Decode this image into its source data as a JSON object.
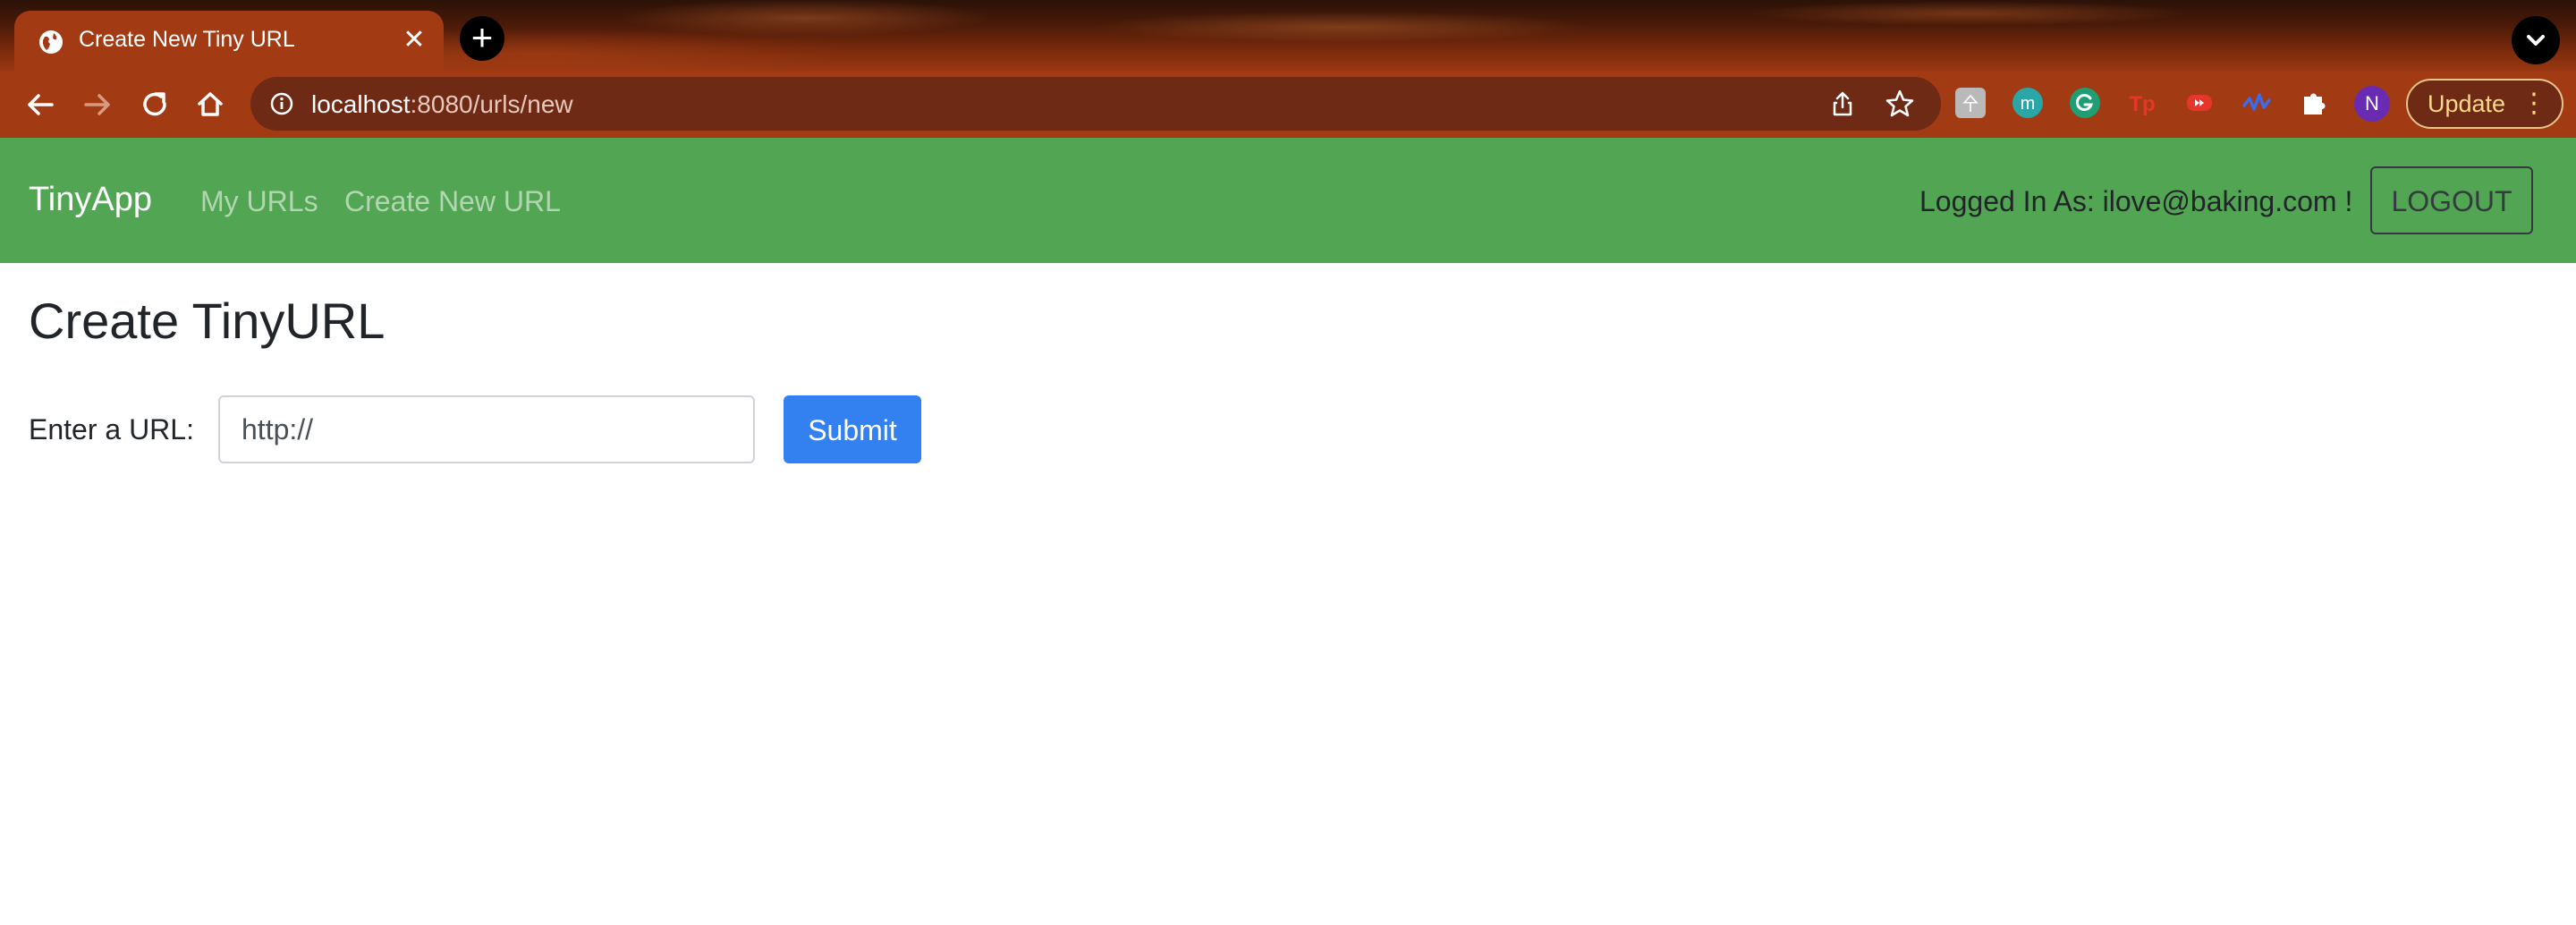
{
  "browser": {
    "tab_title": "Create New Tiny URL",
    "url_host": "localhost",
    "url_rest": ":8080/urls/new",
    "profile_initial": "N",
    "update_label": "Update"
  },
  "navbar": {
    "brand": "TinyApp",
    "links": [
      "My URLs",
      "Create New URL"
    ],
    "logged_in_text": "Logged In As: ilove@baking.com !",
    "logout_label": "LOGOUT"
  },
  "main": {
    "heading": "Create TinyURL",
    "url_label": "Enter a URL:",
    "url_value": "http://",
    "submit_label": "Submit"
  },
  "colors": {
    "navbar": "#52a552",
    "submit": "#3380f0",
    "chrome": "#a23a14"
  },
  "icons": {
    "extensions": [
      "extension-icon",
      "m-extension-icon",
      "grammarly-icon",
      "tp-extension-icon",
      "video-extension-icon",
      "wave-extension-icon",
      "puzzle-icon"
    ]
  }
}
